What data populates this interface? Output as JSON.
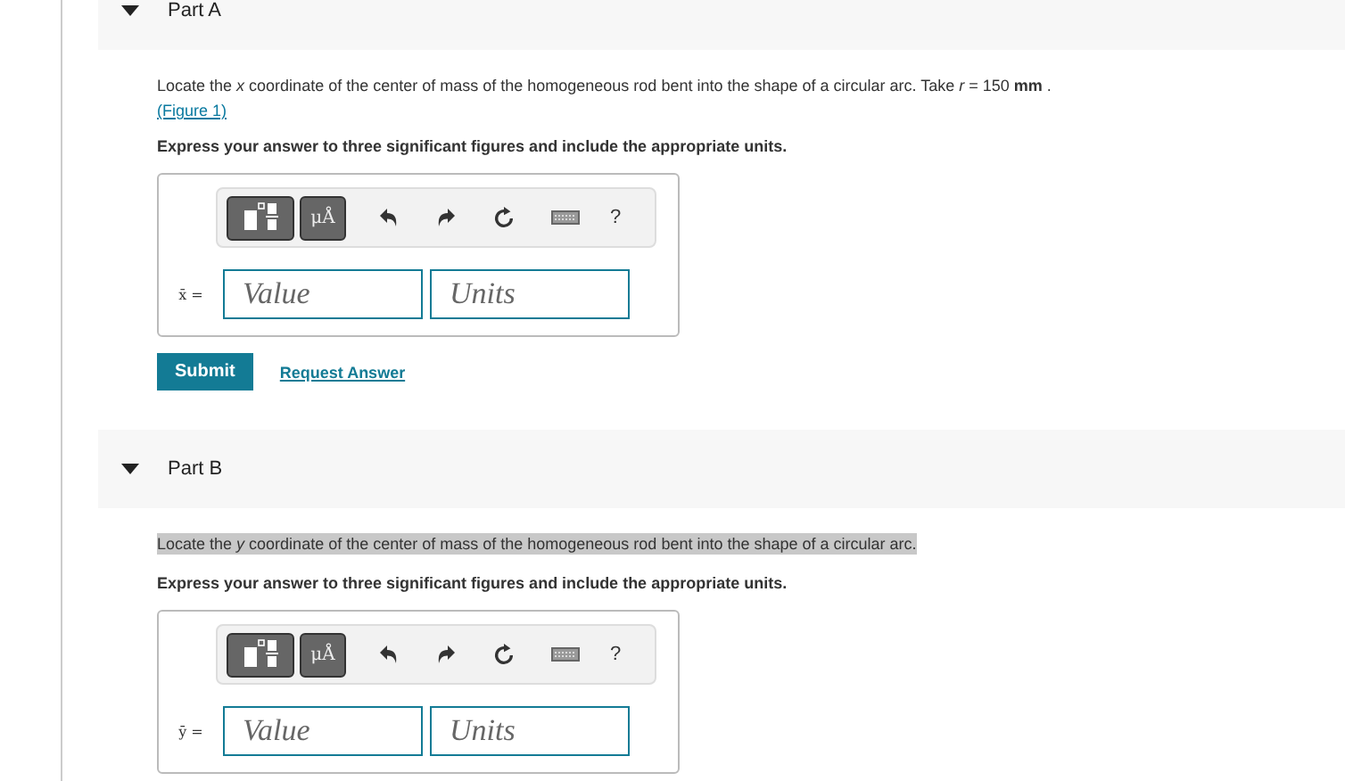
{
  "parts": [
    {
      "label": "Part A",
      "expanded": true,
      "highlighted": false,
      "prompt": "Locate the *x* coordinate of the center of mass of the homogeneous rod bent into the shape of a circular arc. Take *r* = 150 **mm** .",
      "figure_link": "(Figure 1)",
      "instruction": "Express your answer to three significant figures and include the appropriate units.",
      "toolbar": {
        "units_button": "μÅ",
        "help": "?"
      },
      "variable": "x̄ =",
      "value_placeholder": "Value",
      "units_placeholder": "Units",
      "submit": "Submit",
      "request": "Request Answer"
    },
    {
      "label": "Part B",
      "expanded": true,
      "highlighted": true,
      "prompt": "Locate the *y* coordinate of the center of mass of the homogeneous rod bent into the shape of a circular arc.",
      "instruction": "Express your answer to three significant figures and include the appropriate units.",
      "toolbar": {
        "units_button": "μÅ",
        "help": "?"
      },
      "variable": "ȳ =",
      "value_placeholder": "Value",
      "units_placeholder": "Units"
    }
  ]
}
